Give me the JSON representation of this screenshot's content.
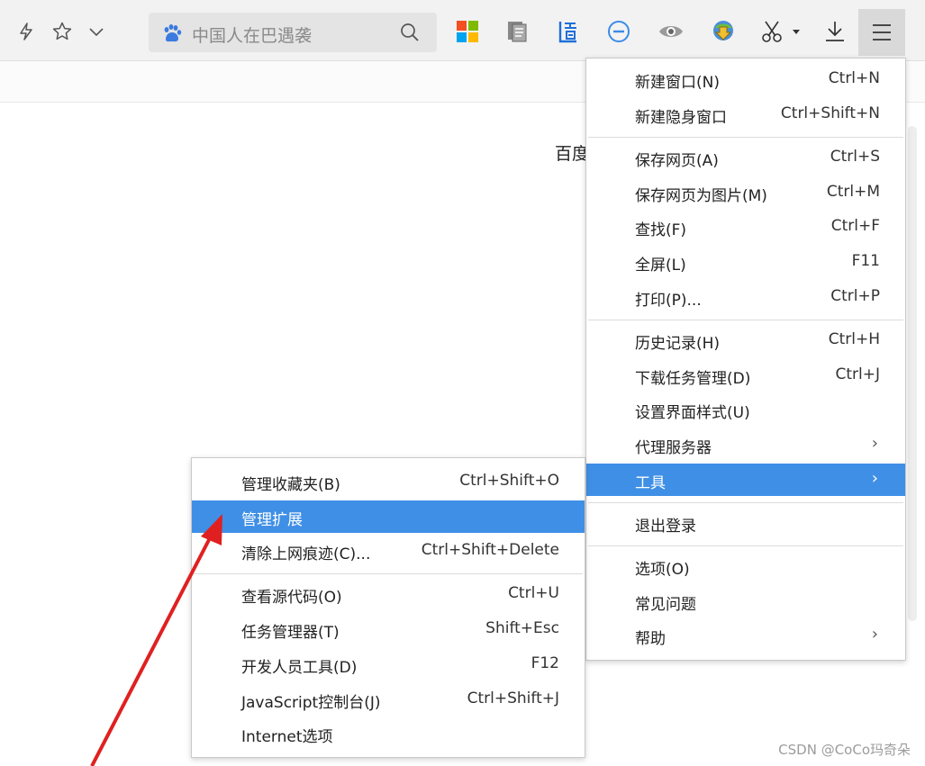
{
  "toolbar": {
    "search_placeholder": "中国人在巴遇袭",
    "icons": [
      "lightning-icon",
      "star-icon",
      "chevron-down-icon",
      "baidu-paw-icon",
      "search-icon",
      "windows-icon",
      "reader-icon",
      "translate-icon",
      "minus-circle-icon",
      "eye-icon",
      "idm-icon",
      "scissors-icon",
      "download-icon",
      "hamburger-menu-icon"
    ]
  },
  "page": {
    "fragment_text": "百度"
  },
  "main_menu": {
    "items": [
      {
        "label": "新建窗口(N)",
        "shortcut": "Ctrl+N"
      },
      {
        "label": "新建隐身窗口",
        "shortcut": "Ctrl+Shift+N"
      },
      {
        "label": "保存网页(A)",
        "shortcut": "Ctrl+S"
      },
      {
        "label": "保存网页为图片(M)",
        "shortcut": "Ctrl+M"
      },
      {
        "label": "查找(F)",
        "shortcut": "Ctrl+F"
      },
      {
        "label": "全屏(L)",
        "shortcut": "F11"
      },
      {
        "label": "打印(P)...",
        "shortcut": "Ctrl+P"
      },
      {
        "label": "历史记录(H)",
        "shortcut": "Ctrl+H"
      },
      {
        "label": "下载任务管理(D)",
        "shortcut": "Ctrl+J"
      },
      {
        "label": "设置界面样式(U)",
        "shortcut": ""
      },
      {
        "label": "代理服务器",
        "shortcut": "",
        "submenu": true
      },
      {
        "label": "工具",
        "shortcut": "",
        "submenu": true,
        "highlighted": true
      },
      {
        "label": "退出登录",
        "shortcut": ""
      },
      {
        "label": "选项(O)",
        "shortcut": ""
      },
      {
        "label": "常见问题",
        "shortcut": ""
      },
      {
        "label": "帮助",
        "shortcut": "",
        "submenu": true
      }
    ]
  },
  "tools_submenu": {
    "items": [
      {
        "label": "管理收藏夹(B)",
        "shortcut": "Ctrl+Shift+O"
      },
      {
        "label": "管理扩展",
        "shortcut": "",
        "highlighted": true
      },
      {
        "label": "清除上网痕迹(C)...",
        "shortcut": "Ctrl+Shift+Delete"
      },
      {
        "label": "查看源代码(O)",
        "shortcut": "Ctrl+U"
      },
      {
        "label": "任务管理器(T)",
        "shortcut": "Shift+Esc"
      },
      {
        "label": "开发人员工具(D)",
        "shortcut": "F12"
      },
      {
        "label": "JavaScript控制台(J)",
        "shortcut": "Ctrl+Shift+J"
      },
      {
        "label": "Internet选项",
        "shortcut": ""
      }
    ]
  },
  "watermark": "CSDN @CoCo玛奇朵",
  "colors": {
    "highlight": "#3f8fe6",
    "annotation_arrow": "#e02020"
  }
}
